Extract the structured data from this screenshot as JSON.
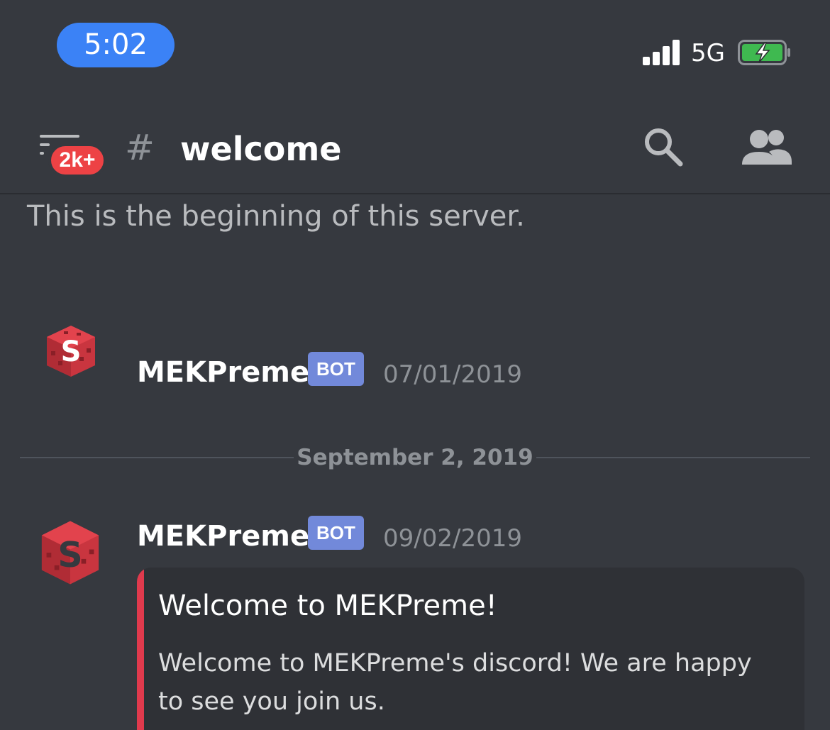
{
  "status_bar": {
    "time": "5:02",
    "network": "5G",
    "signal_icon": "cellular-signal-icon",
    "battery_icon": "battery-charging-icon",
    "battery_color": "#3fb950",
    "time_pill_color": "#3b82f6"
  },
  "header": {
    "menu_icon": "hamburger-menu-icon",
    "unread_badge": "2k+",
    "channel_prefix": "#",
    "channel_name": "welcome",
    "search_icon": "search-icon",
    "members_icon": "members-icon"
  },
  "channel": {
    "beginning_text": "This is the beginning of this server."
  },
  "messages": [
    {
      "author": "MEKPreme",
      "tag": "BOT",
      "timestamp": "07/01/2019",
      "avatar_icon": "mekpreme-logo-icon"
    },
    {
      "author": "MEKPreme",
      "tag": "BOT",
      "timestamp": "09/02/2019",
      "avatar_icon": "mekpreme-logo-icon",
      "embed": {
        "title": "Welcome to MEKPreme!",
        "description": "Welcome to MEKPreme's discord! We are happy to see you join us.",
        "accent_color": "#e03a4d"
      }
    }
  ],
  "date_divider": "September 2, 2019",
  "colors": {
    "background": "#36393f",
    "bot_tag": "#7289da",
    "badge": "#ed4245",
    "embed_bg": "#2f3136"
  }
}
